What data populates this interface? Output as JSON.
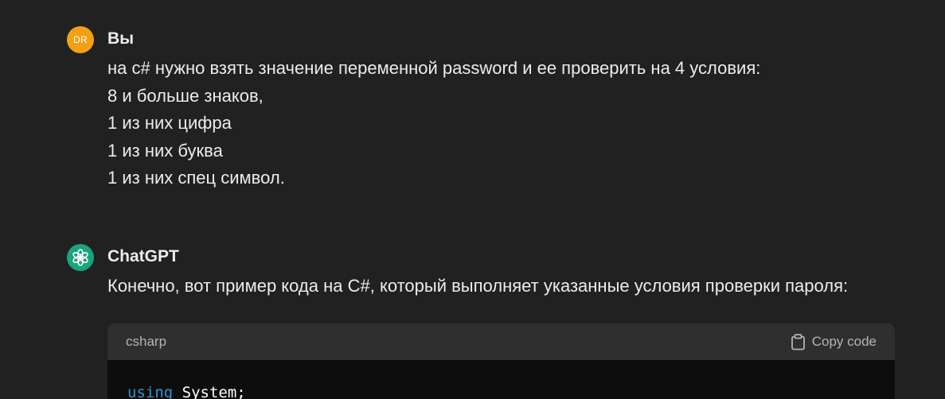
{
  "user_message": {
    "avatar_initials": "DR",
    "author": "Вы",
    "lines": [
      "на c# нужно взять значение переменной password и ее проверить на 4 условия:",
      "8 и больше знаков,",
      "1 из них цифра",
      "1 из них буква",
      "1 из них спец символ."
    ]
  },
  "assistant_message": {
    "author": "ChatGPT",
    "text": "Конечно, вот пример кода на C#, который выполняет указанные условия проверки пароля:",
    "avatar_icon": "openai-logo-icon"
  },
  "code_block": {
    "language": "csharp",
    "copy_label": "Copy code",
    "copy_icon": "clipboard-icon",
    "first_line_keyword": "using",
    "first_line_rest": " System;"
  },
  "colors": {
    "background": "#212121",
    "user_avatar": "#f4a014",
    "gpt_avatar": "#19a37f",
    "code_header": "#2f2f2f",
    "code_bg": "#0d0d0d",
    "keyword": "#2e95d3"
  }
}
